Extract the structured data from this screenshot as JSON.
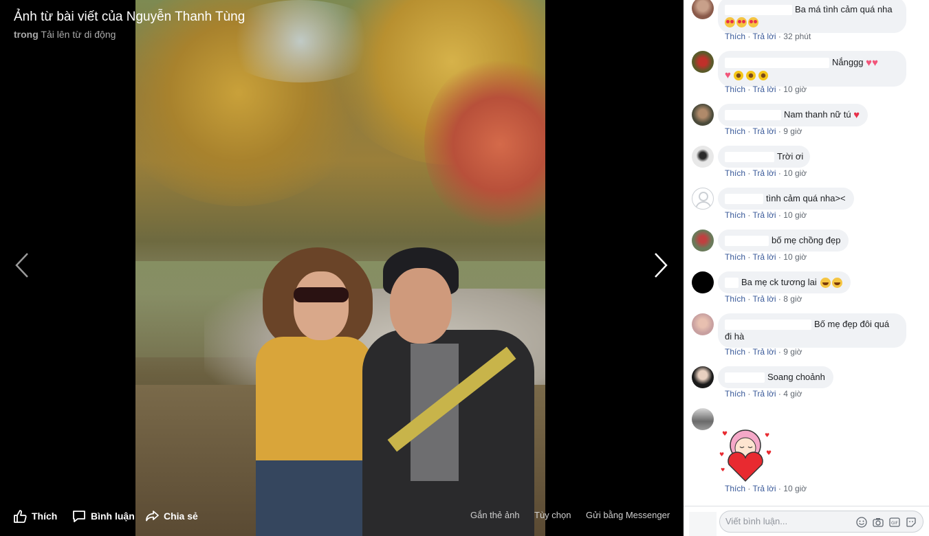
{
  "viewer": {
    "title": "Ảnh từ bài viết của Nguyễn Thanh Tùng",
    "subtitle_prefix": "trong",
    "subtitle_album": "Tải lên từ di động",
    "actions": {
      "like": "Thích",
      "comment": "Bình luận",
      "share": "Chia sẻ"
    },
    "right_links": {
      "tag": "Gắn thẻ ảnh",
      "options": "Tùy chọn",
      "send": "Gửi bằng Messenger"
    },
    "icons": {
      "prev": "chevron-left-icon",
      "next": "chevron-right-icon"
    }
  },
  "comment_labels": {
    "like": "Thích",
    "reply": "Trả lời",
    "sep": "·"
  },
  "comments": [
    {
      "text": "Ba má tình cảm quá nha",
      "emoji": [
        "heart-eyes",
        "heart-eyes",
        "heart-eyes"
      ],
      "time": "32 phút"
    },
    {
      "text": "Nắnggg",
      "emoji": [
        "heart",
        "heart",
        "sunflower",
        "sunflower",
        "sunflower"
      ],
      "time": "10 giờ"
    },
    {
      "text": "Nam thanh nữ tú",
      "emoji": [
        "red-heart"
      ],
      "time": "9 giờ"
    },
    {
      "text": "Trời ơi",
      "time": "10 giờ"
    },
    {
      "text": "tình cảm quá nha><",
      "time": "10 giờ"
    },
    {
      "text": "bố mẹ chồng đẹp",
      "time": "10 giờ"
    },
    {
      "text": "Ba mẹ ck tương lai",
      "emoji": [
        "grin",
        "grin"
      ],
      "time": "8 giờ"
    },
    {
      "text": "Bố mẹ đẹp đôi quá",
      "text2": "đi hà",
      "time": "9 giờ"
    },
    {
      "text": "Soang choảnh",
      "time": "4 giờ"
    },
    {
      "sticker": "pink-hair-girl-heart-sticker",
      "time": "10 giờ"
    }
  ],
  "composer": {
    "placeholder": "Viết bình luận..."
  },
  "colors": {
    "link": "#385898",
    "bubble": "#f0f2f5",
    "meta": "#606770"
  }
}
